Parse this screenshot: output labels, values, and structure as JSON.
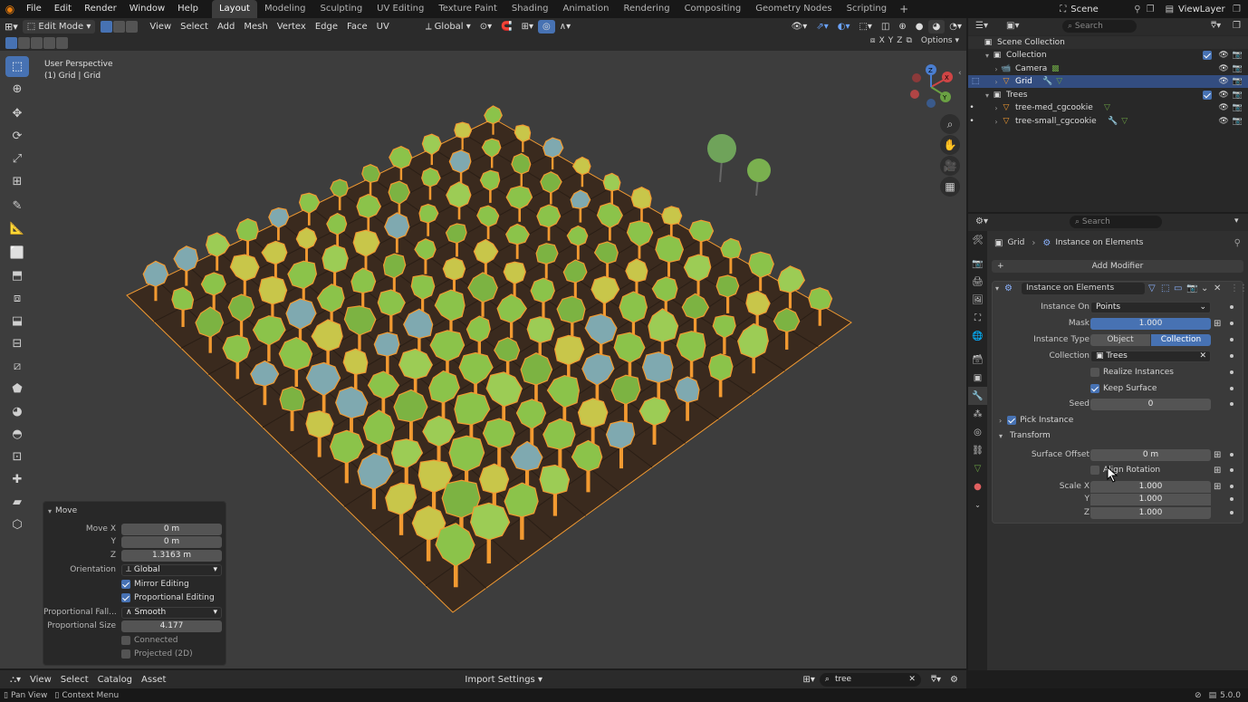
{
  "top_menu": [
    "File",
    "Edit",
    "Render",
    "Window",
    "Help"
  ],
  "workspaces": [
    "Layout",
    "Modeling",
    "Sculpting",
    "UV Editing",
    "Texture Paint",
    "Shading",
    "Animation",
    "Rendering",
    "Compositing",
    "Geometry Nodes",
    "Scripting"
  ],
  "active_workspace": "Layout",
  "scene_label": "Scene",
  "viewlayer_label": "ViewLayer",
  "viewport_header": {
    "mode": "Edit Mode",
    "menus": [
      "View",
      "Select",
      "Add",
      "Mesh",
      "Vertex",
      "Edge",
      "Face",
      "UV"
    ],
    "transform_orientation": "Global",
    "axes": [
      "X",
      "Y",
      "Z"
    ],
    "options": "Options"
  },
  "viewport": {
    "perspective_label": "User Perspective",
    "object_label": "(1) Grid | Grid"
  },
  "move_panel": {
    "title": "Move",
    "move_x_label": "Move X",
    "move_x": "0 m",
    "y_label": "Y",
    "y": "0 m",
    "z_label": "Z",
    "z": "1.3163 m",
    "orientation_label": "Orientation",
    "orientation": "Global",
    "mirror_editing": "Mirror Editing",
    "proportional_editing": "Proportional Editing",
    "falloff_label": "Proportional Fall...",
    "falloff": "Smooth",
    "size_label": "Proportional Size",
    "size": "4.177",
    "connected": "Connected",
    "projected": "Projected (2D)"
  },
  "bottom_bar": {
    "menus": [
      "View",
      "Select",
      "Catalog",
      "Asset"
    ],
    "import_settings": "Import Settings",
    "search_value": "tree"
  },
  "status_bar": {
    "pan_view": "Pan View",
    "context_menu": "Context Menu",
    "version": "5.0.0"
  },
  "outliner": {
    "search_placeholder": "Search",
    "scene_collection": "Scene Collection",
    "collection": "Collection",
    "camera": "Camera",
    "grid": "Grid",
    "trees": "Trees",
    "tree_med": "tree-med_cgcookie",
    "tree_small": "tree-small_cgcookie"
  },
  "properties": {
    "search_placeholder": "Search",
    "breadcrumb_object": "Grid",
    "breadcrumb_modifier": "Instance on Elements",
    "add_modifier": "Add Modifier",
    "modifier_name": "Instance on Elements",
    "instance_on_label": "Instance On",
    "instance_on": "Points",
    "mask_label": "Mask",
    "mask": "1.000",
    "mask_fraction": 1.0,
    "instance_type_label": "Instance Type",
    "type_object": "Object",
    "type_collection": "Collection",
    "collection_label": "Collection",
    "collection": "Trees",
    "realize_instances": "Realize Instances",
    "keep_surface": "Keep Surface",
    "seed_label": "Seed",
    "seed": "0",
    "pick_instance": "Pick Instance",
    "transform": "Transform",
    "surface_offset_label": "Surface Offset",
    "surface_offset": "0 m",
    "align_rotation": "Align Rotation",
    "scale_x_label": "Scale X",
    "scale_x": "1.000",
    "scale_y_label": "Y",
    "scale_y": "1.000",
    "scale_z_label": "Z",
    "scale_z": "1.000"
  },
  "colors": {
    "accent": "#4772b3",
    "selection": "#334d80",
    "viewport_bg": "#3d3d3d",
    "tree_green": "#8bc34a",
    "tree_yellow": "#c8c64a",
    "tree_blue": "#7fa9b0",
    "outline_orange": "#f29a31",
    "ground": "#3a2a1e"
  }
}
